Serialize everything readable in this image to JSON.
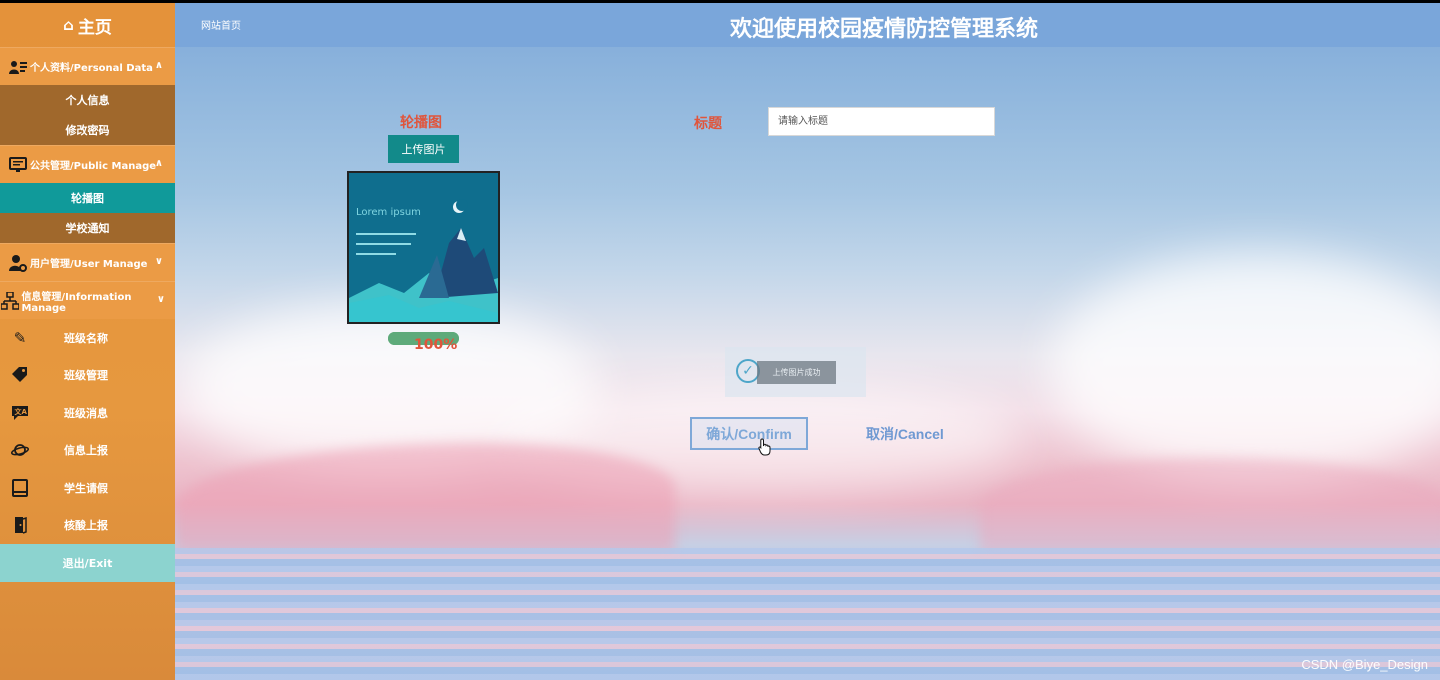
{
  "sidebar": {
    "home_label": "主页",
    "groups": [
      {
        "label": "个人资料/Personal Data",
        "items": [
          "个人信息",
          "修改密码"
        ]
      },
      {
        "label": "公共管理/Public Manage",
        "items": [
          "轮播图",
          "学校通知"
        ]
      },
      {
        "label": "用户管理/User Manage"
      },
      {
        "label": "信息管理/Information Manage"
      }
    ],
    "items": [
      "班级名称",
      "班级管理",
      "班级消息",
      "信息上报",
      "学生请假",
      "核酸上报"
    ],
    "exit_label": "退出/Exit"
  },
  "header": {
    "breadcrumb": "网站首页",
    "title": "欢迎使用校园疫情防控管理系统"
  },
  "form": {
    "carousel_label": "轮播图",
    "upload_button": "上传图片",
    "progress_text": "100%",
    "progress_value": 100,
    "title_label": "标题",
    "title_placeholder": "请输入标题",
    "preview_text": "Lorem ipsum",
    "toast_message": "上传图片成功",
    "confirm_button": "确认/Confirm",
    "cancel_button": "取消/Cancel"
  },
  "watermark": "CSDN @Biye_Design",
  "colors": {
    "sidebar_bg": "#e4923a",
    "sidebar_active": "#109a9a",
    "header_bg": "#7aa6da",
    "label_red": "#e0553c",
    "upload_btn": "#128a8a",
    "exit_bg": "#8cd3cf"
  }
}
